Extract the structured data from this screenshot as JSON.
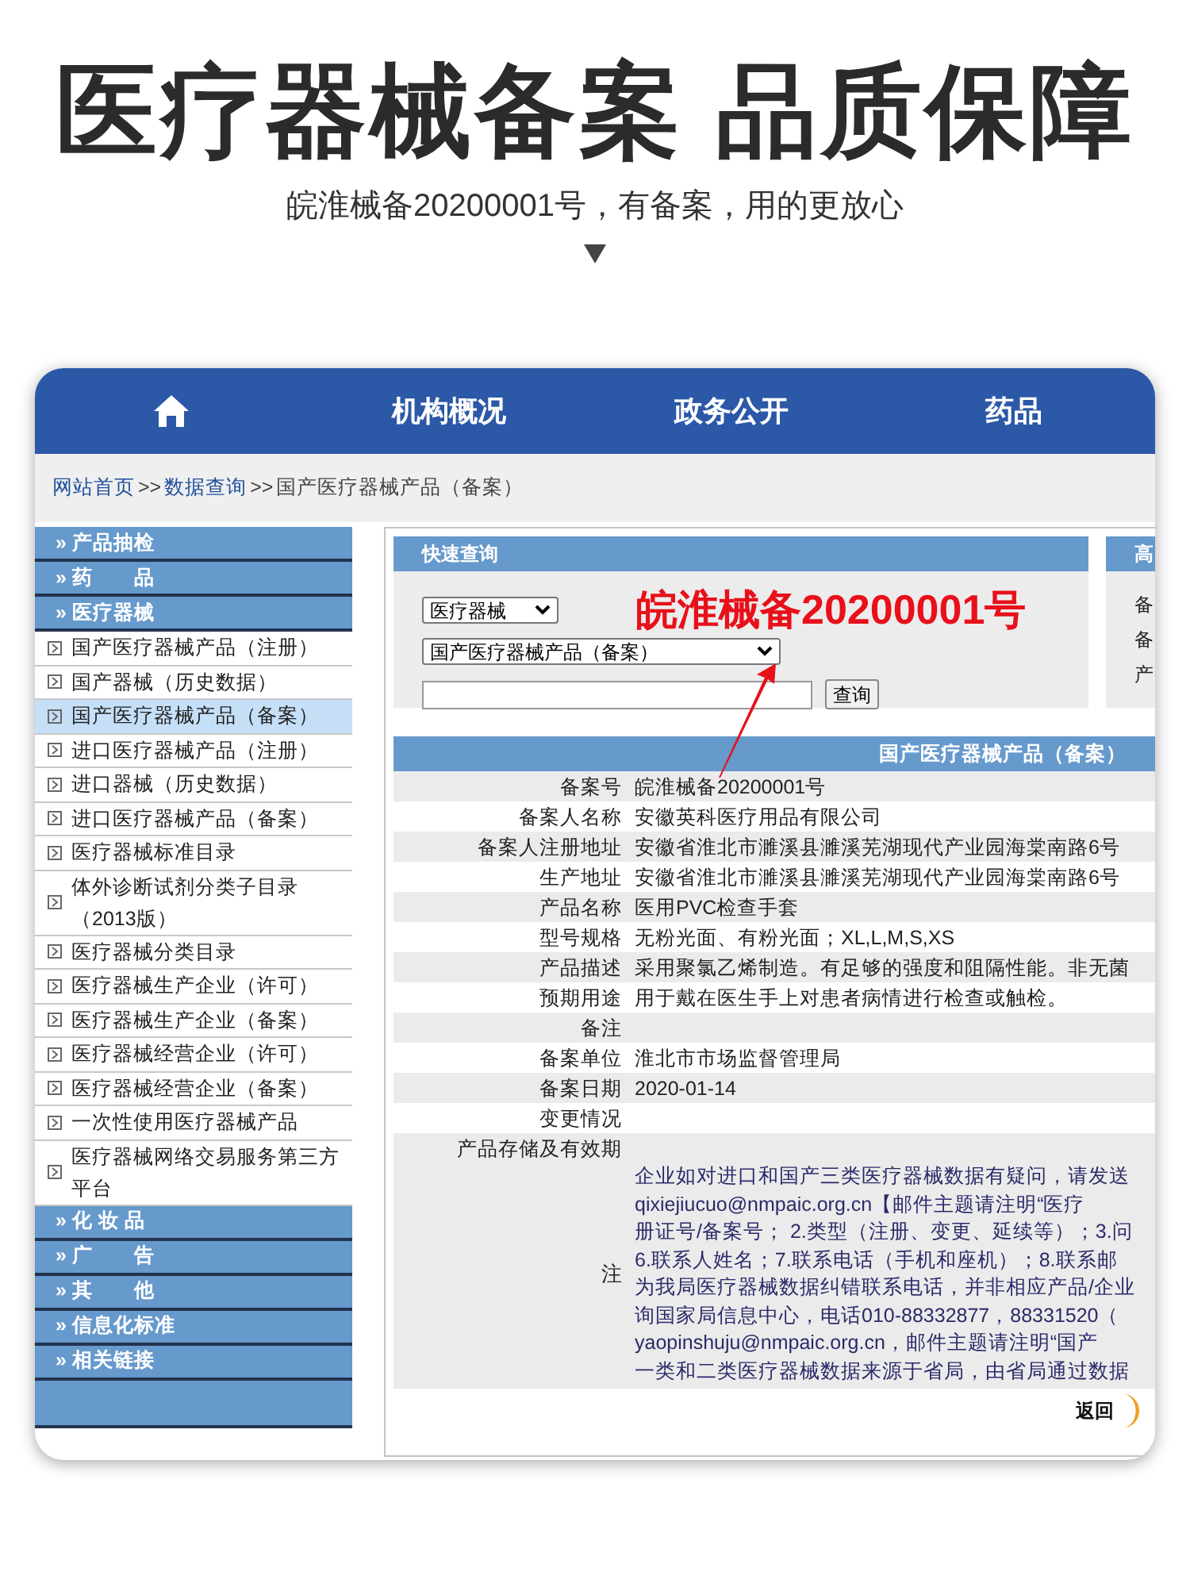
{
  "banner": {
    "title": "医疗器械备案 品质保障",
    "subtitle": "皖淮械备20200001号，有备案，用的更放心"
  },
  "nav": {
    "items": [
      "机构概况",
      "政务公开",
      "药品"
    ]
  },
  "breadcrumb": {
    "links": [
      "网站首页",
      "数据查询"
    ],
    "separator": ">>",
    "current": "国产医疗器械产品（备案）"
  },
  "sidebar": {
    "items": [
      {
        "kind": "header",
        "label": "» 产品抽检"
      },
      {
        "kind": "header",
        "label": "» 药　　品"
      },
      {
        "kind": "header",
        "label": "» 医疗器械"
      },
      {
        "kind": "item",
        "label": "国产医疗器械产品（注册）",
        "selected": false
      },
      {
        "kind": "item",
        "label": "国产器械（历史数据）",
        "selected": false
      },
      {
        "kind": "item",
        "label": "国产医疗器械产品（备案）",
        "selected": true
      },
      {
        "kind": "item",
        "label": "进口医疗器械产品（注册）",
        "selected": false
      },
      {
        "kind": "item",
        "label": "进口器械（历史数据）",
        "selected": false
      },
      {
        "kind": "item",
        "label": "进口医疗器械产品（备案）",
        "selected": false
      },
      {
        "kind": "item",
        "label": "医疗器械标准目录",
        "selected": false
      },
      {
        "kind": "item",
        "label": "体外诊断试剂分类子目录（2013版）",
        "selected": false
      },
      {
        "kind": "item",
        "label": "医疗器械分类目录",
        "selected": false
      },
      {
        "kind": "item",
        "label": "医疗器械生产企业（许可）",
        "selected": false
      },
      {
        "kind": "item",
        "label": "医疗器械生产企业（备案）",
        "selected": false
      },
      {
        "kind": "item",
        "label": "医疗器械经营企业（许可）",
        "selected": false
      },
      {
        "kind": "item",
        "label": "医疗器械经营企业（备案）",
        "selected": false
      },
      {
        "kind": "item",
        "label": "一次性使用医疗器械产品",
        "selected": false
      },
      {
        "kind": "item",
        "label": "医疗器械网络交易服务第三方平台",
        "selected": false
      },
      {
        "kind": "header",
        "label": "» 化 妆 品"
      },
      {
        "kind": "header",
        "label": "» 广　　告"
      },
      {
        "kind": "header",
        "label": "» 其　　他"
      },
      {
        "kind": "header",
        "label": "» 信息化标准"
      },
      {
        "kind": "header",
        "label": "» 相关链接"
      }
    ]
  },
  "quick_search": {
    "title": "快速查询",
    "category": "医疗器械",
    "subcategory": "国产医疗器械产品（备案）",
    "button": "查询"
  },
  "advanced_panel": {
    "title": "高",
    "labels": [
      "备",
      "备",
      "产"
    ]
  },
  "annotation": "皖淮械备20200001号",
  "record": {
    "title": "国产医疗器械产品（备案）",
    "rows": [
      {
        "label": "备案号",
        "value": "皖淮械备20200001号"
      },
      {
        "label": "备案人名称",
        "value": "安徽英科医疗用品有限公司"
      },
      {
        "label": "备案人注册地址",
        "value": "安徽省淮北市濉溪县濉溪芜湖现代产业园海棠南路6号"
      },
      {
        "label": "生产地址",
        "value": "安徽省淮北市濉溪县濉溪芜湖现代产业园海棠南路6号"
      },
      {
        "label": "产品名称",
        "value": "医用PVC检查手套"
      },
      {
        "label": "型号规格",
        "value": "无粉光面、有粉光面；XL,L,M,S,XS"
      },
      {
        "label": "产品描述",
        "value": "采用聚氯乙烯制造。有足够的强度和阻隔性能。非无菌"
      },
      {
        "label": "预期用途",
        "value": "用于戴在医生手上对患者病情进行检查或触检。"
      },
      {
        "label": "备注"
      },
      {
        "label": "备案单位",
        "value": "淮北市市场监督管理局"
      },
      {
        "label": "备案日期",
        "value": "2020-01-14"
      },
      {
        "label": "变更情况"
      },
      {
        "label": "产品存储及有效期"
      }
    ],
    "note": {
      "label": "注",
      "lines": [
        "企业如对进口和国产三类医疗器械数据有疑问，请发送",
        "qixiejiucuo@nmpaic.org.cn【邮件主题请注明“医疗",
        "册证号/备案号； 2.类型（注册、变更、延续等）；3.问",
        "6.联系人姓名；7.联系电话（手机和座机）；8.联系邮",
        "为我局医疗器械数据纠错联系电话，并非相应产品/企业",
        "询国家局信息中心，电话010-88332877，88331520（",
        "yaopinshuju@nmpaic.org.cn，邮件主题请注明“国产",
        "一类和二类医疗器械数据来源于省局，由省局通过数据"
      ]
    }
  },
  "back_button": "返回"
}
